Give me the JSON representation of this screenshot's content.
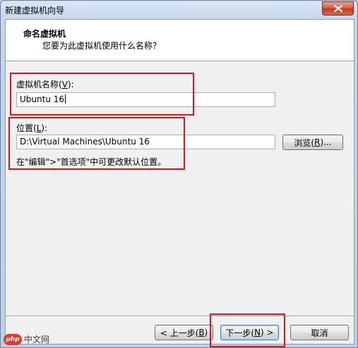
{
  "window": {
    "title": "新建虚拟机向导"
  },
  "header": {
    "title": "命名虚拟机",
    "subtitle": "您要为此虚拟机使用什么名称?"
  },
  "name_field": {
    "label_prefix": "虚拟机名称(",
    "label_hotkey": "V",
    "label_suffix": "):",
    "value": "Ubuntu 16"
  },
  "location_field": {
    "label_prefix": "位置(",
    "label_hotkey": "L",
    "label_suffix": "):",
    "value": "D:\\Virtual Machines\\Ubuntu 16",
    "hint": "在\"编辑\">\"首选项\"中可更改默认位置。"
  },
  "buttons": {
    "browse_prefix": "浏览(",
    "browse_hotkey": "R",
    "browse_suffix": ")...",
    "back_prefix": "< 上一步(",
    "back_hotkey": "B",
    "back_suffix": ")",
    "next_prefix": "下一步(",
    "next_hotkey": "N",
    "next_suffix": ") >",
    "cancel": "取消"
  },
  "watermark": {
    "logo": "php",
    "text": "中文网"
  },
  "colors": {
    "highlight": "#e0141b",
    "client_bg": "#f0f0f0",
    "close_button": "#c23b1e"
  },
  "icons": {
    "close": "close-icon"
  }
}
